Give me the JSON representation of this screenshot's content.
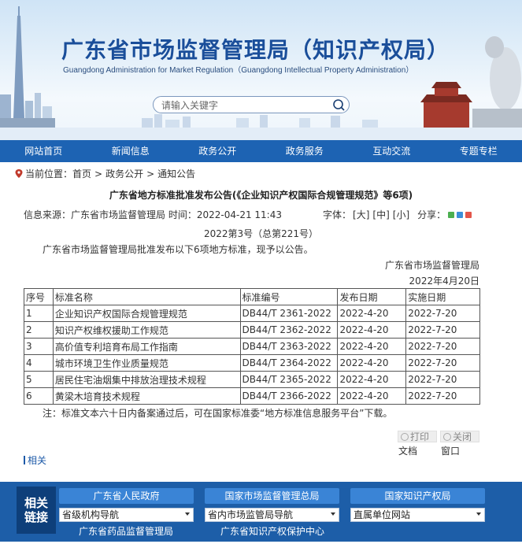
{
  "header": {
    "title_cn": "广东省市场监督管理局（知识产权局）",
    "title_en": "Guangdong Administration for Market Regulation（Guangdong Intellectual Property Administration）",
    "search_placeholder": "请输入关键字"
  },
  "nav": [
    "网站首页",
    "新闻信息",
    "政务公开",
    "政务服务",
    "互动交流",
    "专题专栏"
  ],
  "breadcrumb": {
    "prefix": "当前位置：",
    "items": [
      "首页",
      "政务公开",
      "通知公告"
    ],
    "separator": ">"
  },
  "article": {
    "title": "广东省地方标准批准发布公告(《企业知识产权国际合规管理规范》等6项)",
    "source_label": "信息来源：广东省市场监督管理局",
    "time_label": "时间：2022-04-21 11:43",
    "font_size_label": "字体：",
    "font_large": "[大]",
    "font_medium": "[中]",
    "font_small": "[小]",
    "share_label": "分享：",
    "doc_number": "2022第3号（总第221号）",
    "intro": "广东省市场监督管理局批准发布以下6项地方标准，现予以公告。",
    "issuer": "广东省市场监督管理局",
    "issue_date": "2022年4月20日",
    "note": "注：标准文本六十日内备案通过后，可在国家标准委“地方标准信息服务平台”下载。"
  },
  "table": {
    "headers": [
      "序号",
      "标准名称",
      "标准编号",
      "发布日期",
      "实施日期"
    ],
    "rows": [
      [
        "1",
        "企业知识产权国际合规管理规范",
        "DB44/T 2361-2022",
        "2022-4-20",
        "2022-7-20"
      ],
      [
        "2",
        "知识产权维权援助工作规范",
        "DB44/T 2362-2022",
        "2022-4-20",
        "2022-7-20"
      ],
      [
        "3",
        "高价值专利培育布局工作指南",
        "DB44/T 2363-2022",
        "2022-4-20",
        "2022-7-20"
      ],
      [
        "4",
        "城市环境卫生作业质量规范",
        "DB44/T 2364-2022",
        "2022-4-20",
        "2022-7-20"
      ],
      [
        "5",
        "居民住宅油烟集中排放治理技术规程",
        "DB44/T 2365-2022",
        "2022-4-20",
        "2022-7-20"
      ],
      [
        "6",
        "黄梁木培育技术规程",
        "DB44/T 2366-2022",
        "2022-4-20",
        "2022-7-20"
      ]
    ]
  },
  "tools": {
    "print_btn": "打印",
    "print_sub": "文档",
    "close_btn": "关闭",
    "close_sub": "窗口"
  },
  "related_label": "相关",
  "footer": {
    "label_line1": "相关",
    "label_line2": "链接",
    "org_buttons": [
      "广东省人民政府",
      "国家市场监督管理总局",
      "国家知识产权局"
    ],
    "selects": [
      "省级机构导航",
      "省内市场监管局导航",
      "直属单位网站"
    ],
    "links": [
      "广东省药品监督管理局",
      "广东省知识产权保护中心"
    ]
  },
  "colors": {
    "nav_bg": "#1d63b3",
    "title_blue": "#1a4e9a",
    "footer_bg": "#1d5ea8"
  }
}
